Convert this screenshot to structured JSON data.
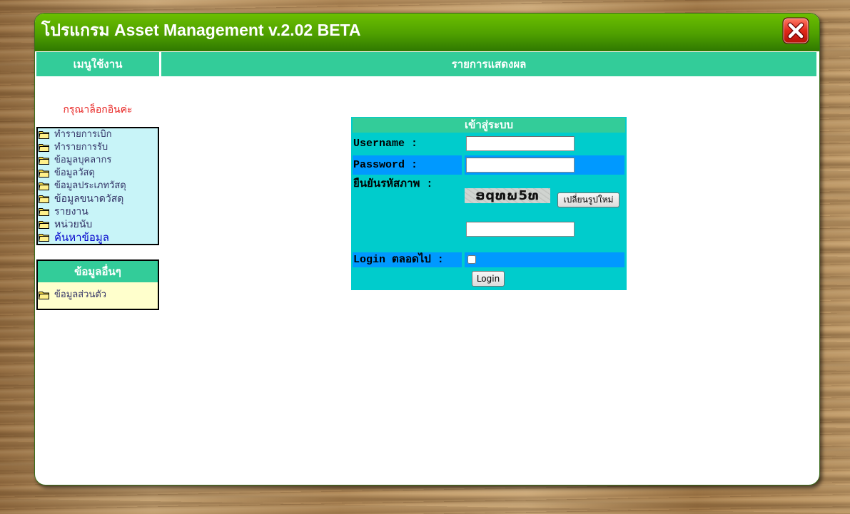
{
  "window": {
    "title": "โปรแกรม Asset Management v.2.02 BETA"
  },
  "headers": {
    "menu": "เมนูใช้งาน",
    "display": "รายการแสดงผล"
  },
  "sidebar": {
    "login_notice": "กรุณาล็อกอินค่ะ",
    "menu": [
      "ทำรายการเบิก",
      "ทำรายการรับ",
      "ข้อมูลบุคลากร",
      "ข้อมูลวัสดุ",
      "ข้อมูลประเภทวัสดุ",
      "ข้อมูลขนาดวัสดุ",
      "รายงาน",
      "หน่วยนับ",
      "ค้นหาข้อมูล"
    ],
    "other_title": "ข้อมูลอื่นๆ",
    "other_items": [
      "ข้อมูลส่วนตัว"
    ]
  },
  "login_form": {
    "title": "เข้าสู่ระบบ",
    "username_label": "Username :",
    "username_value": "",
    "password_label": "Password :",
    "password_value": "",
    "captcha_label": "ยืนยันรหัสภาพ :",
    "captcha_text": "ອqທພ5ທ",
    "captcha_refresh_label": "เปลี่ยนรูปใหม่",
    "captcha_value": "",
    "remember_label": "Login ตลอดไป :",
    "remember_checked": false,
    "submit_label": "Login"
  },
  "icons": {
    "close": "close-icon",
    "folder": "folder-icon"
  },
  "colors": {
    "title_green_top": "#6cbf00",
    "title_green_bottom": "#2f7800",
    "accent": "#33cc99",
    "form_bg": "#00cccc",
    "row_blue": "#0099ff",
    "menu_bg": "#c8f4f8",
    "other_bg": "#ffffcc",
    "notice": "#e8201e",
    "menu_text": "#333366",
    "menu_link": "#0000cc"
  }
}
